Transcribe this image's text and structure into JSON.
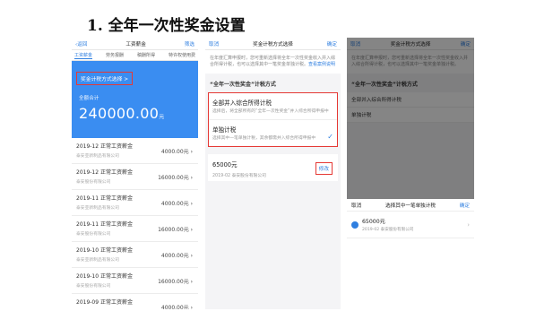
{
  "title": "1. 全年一次性奖金设置",
  "p1": {
    "back": "‹返回",
    "header": "工资薪金",
    "right": "筛选",
    "tabs": [
      "工资薪金",
      "劳务报酬",
      "稿酬所得",
      "特许权使用费"
    ],
    "method_btn": "奖金计税方式选择 >",
    "total_label": "全额合计",
    "total": "240000.00",
    "unit": "元",
    "rows": [
      {
        "a": "2019-12 正常工资薪金",
        "b": "泰安亚新制品有限公司",
        "c": "4000.00元 ›"
      },
      {
        "a": "2019-12 正常工资薪金",
        "b": "泰安股份有限公司",
        "c": "16000.00元 ›"
      },
      {
        "a": "2019-11 正常工资薪金",
        "b": "泰安亚新制品有限公司",
        "c": "4000.00元 ›"
      },
      {
        "a": "2019-11 正常工资薪金",
        "b": "泰安股份有限公司",
        "c": "16000.00元 ›"
      },
      {
        "a": "2019-10 正常工资薪金",
        "b": "泰安亚新制品有限公司",
        "c": "4000.00元 ›"
      },
      {
        "a": "2019-10 正常工资薪金",
        "b": "泰安股份有限公司",
        "c": "16000.00元 ›"
      },
      {
        "a": "2019-09 正常工资薪金",
        "b": "泰安亚新制品有限公司",
        "c": "4000.00元 ›"
      }
    ]
  },
  "p2": {
    "cancel": "取消",
    "header": "奖金计税方式选择",
    "ok": "确定",
    "desc": "在年度汇算申报时，您可重新选择将全年一次性奖金收入并入综合所得计税，也可以选择其中一笔奖金单独计税。",
    "desc_link": "查看案例说明",
    "section": "“全年一次性奖金”计税方式",
    "opt1_t": "全部并入综合所得计税",
    "opt1_s": "选择后，将全部所有的“全年一次性奖金”并入综合所得申报中",
    "opt2_t": "单独计税",
    "opt2_s": "选择其中一笔单独计税，其余都需并入综合所得申报中",
    "amount": "65000元",
    "company": "2019-02 泰安股份有限公司",
    "edit": "修改"
  },
  "p3": {
    "cancel": "取消",
    "header": "奖金计税方式选择",
    "ok": "确定",
    "desc": "在年度汇算申报时，您可重新选择将全年一次性奖金收入并入综合所得计税，也可以选择其中一笔奖金单独计税。",
    "section": "“全年一次性奖金”计税方式",
    "opt1": "全部并入综合所得计税",
    "opt2": "单独计税",
    "sheet_cancel": "取消",
    "sheet_title": "选择其中一笔单独计税",
    "sheet_ok": "确定",
    "amount": "65000元",
    "company": "2019-02 泰安股份有限公司"
  }
}
